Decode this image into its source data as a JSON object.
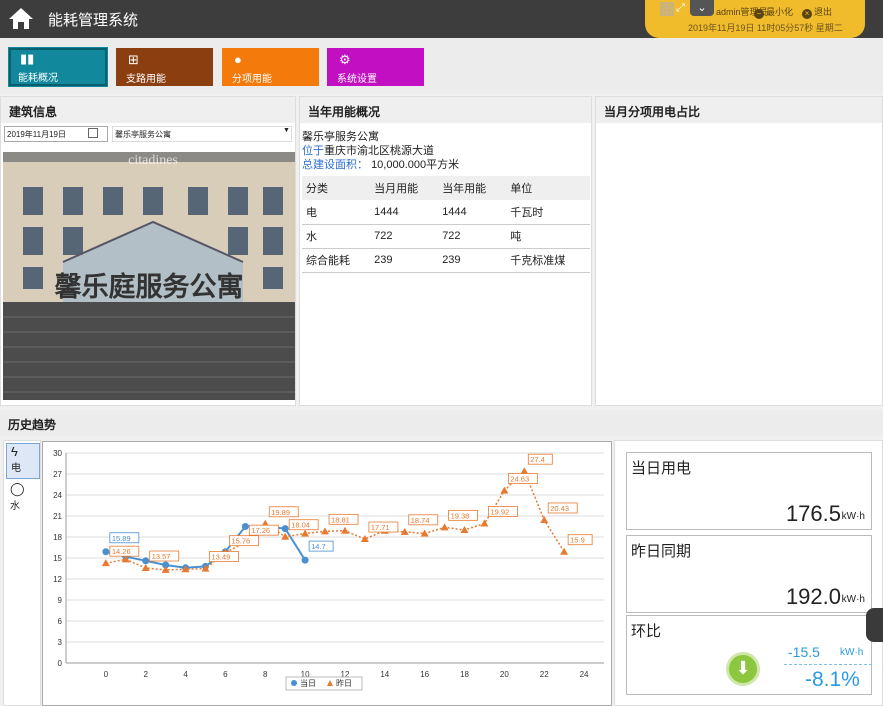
{
  "app": {
    "title": "能耗管理系统"
  },
  "toolbar": {
    "admin": "admin管理员",
    "minimize": "最小化",
    "exit": "退出",
    "datetime": "2019年11月19日  11时05分57秒 星期二"
  },
  "nav": [
    {
      "label": "能耗概况",
      "icon": "chart-icon"
    },
    {
      "label": "支路用能",
      "icon": "presentation-icon"
    },
    {
      "label": "分项用能",
      "icon": "user-icon"
    },
    {
      "label": "系统设置",
      "icon": "gear-icon"
    }
  ],
  "panels": {
    "building": "建筑信息",
    "year": "当年用能概况",
    "month": "当月分项用电占比",
    "trend": "历史趋势"
  },
  "building": {
    "date": "2019年11月19日",
    "select": "馨乐亭服务公寓",
    "photo_sign": "馨乐庭服务公寓",
    "photo_top": "citadines"
  },
  "overview": {
    "name": "馨乐亭服务公寓",
    "addr_prefix": "位于",
    "addr": "重庆市渝北区桃源大道",
    "area_label": "总建设面积：",
    "area": "10,000.000平方米"
  },
  "table": {
    "headers": [
      "分类",
      "当月用能",
      "当年用能",
      "单位"
    ],
    "rows": [
      [
        "电",
        "1444",
        "1444",
        "千瓦时"
      ],
      [
        "水",
        "722",
        "722",
        "吨"
      ],
      [
        "综合能耗",
        "239",
        "239",
        "千克标准煤"
      ]
    ]
  },
  "side_tabs": [
    {
      "label": "电",
      "icon": "lightning-icon"
    },
    {
      "label": "水",
      "icon": "drop-icon"
    }
  ],
  "chart_data": {
    "type": "line",
    "x": [
      0,
      1,
      2,
      3,
      4,
      5,
      6,
      7,
      8,
      9,
      10,
      11,
      12,
      13,
      14,
      15,
      16,
      17,
      18,
      19,
      20,
      21,
      22,
      23
    ],
    "xticks": [
      0,
      2,
      4,
      6,
      8,
      10,
      12,
      14,
      16,
      18,
      20,
      22,
      24
    ],
    "yticks": [
      0,
      3,
      6,
      9,
      12,
      15,
      18,
      21,
      24,
      27,
      30
    ],
    "xlim": [
      -2,
      25
    ],
    "ylim": [
      0,
      30
    ],
    "series": [
      {
        "name": "当日",
        "color": "#4a8fd0",
        "values": [
          15.89,
          15.2,
          14.6,
          14.0,
          13.6,
          13.8,
          15.9,
          19.5,
          19.5,
          19.2,
          14.7
        ]
      },
      {
        "name": "昨日",
        "color": "#e87a30",
        "values": [
          14.26,
          14.8,
          13.57,
          13.3,
          13.4,
          13.49,
          15.76,
          17.26,
          19.89,
          18.04,
          18.5,
          18.81,
          18.9,
          17.71,
          18.9,
          18.74,
          18.5,
          19.38,
          19.0,
          19.92,
          24.63,
          27.4,
          20.43,
          15.9
        ]
      }
    ],
    "labels": {
      "当日": [
        [
          0,
          "15.89"
        ],
        [
          10,
          "14.7"
        ]
      ],
      "昨日": [
        [
          0,
          "14.26"
        ],
        [
          2,
          "13.57"
        ],
        [
          5,
          "13.49"
        ],
        [
          6,
          "15.76"
        ],
        [
          7,
          "17.26"
        ],
        [
          8,
          "19.89"
        ],
        [
          9,
          "18.04"
        ],
        [
          11,
          "18.81"
        ],
        [
          13,
          "17.71"
        ],
        [
          15,
          "18.74"
        ],
        [
          17,
          "19.38"
        ],
        [
          19,
          "19.92"
        ],
        [
          20,
          "24.63"
        ],
        [
          21,
          "27.4"
        ],
        [
          22,
          "20.43"
        ],
        [
          23,
          "15.9"
        ]
      ]
    },
    "legend": "bottom-center",
    "grid": true
  },
  "stats": {
    "today_label": "当日用电",
    "today_val": "176.5",
    "yest_label": "昨日同期",
    "yest_val": "192.0",
    "unit": "kW·h",
    "ratio_label": "环比",
    "ratio_val": "-15.5",
    "ratio_unit": "kW·h",
    "ratio_pct": "-8.1%"
  }
}
